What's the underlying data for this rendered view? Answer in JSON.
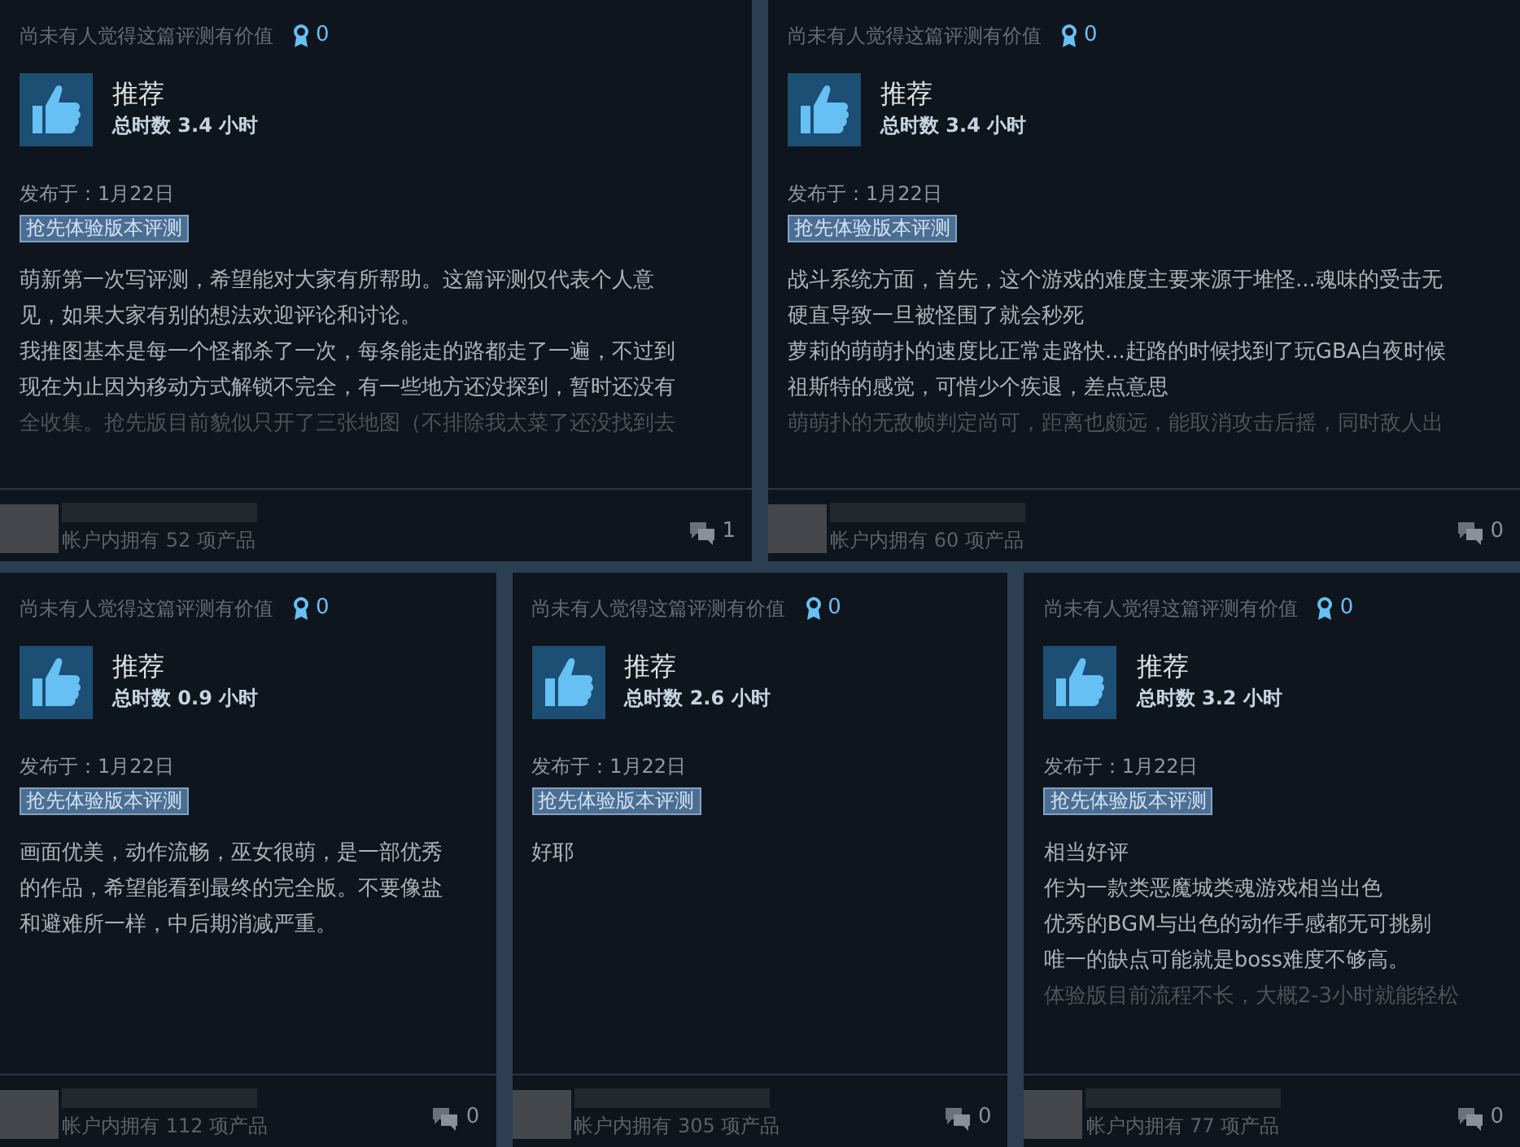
{
  "reviews": [
    {
      "helpful_text": "尚未有人觉得这篇评测有价值",
      "awards": "0",
      "recommended": true,
      "verdict": "推荐",
      "hours": "总时数 3.4 小时",
      "posted": "发布于：1月22日",
      "badge": "抢先体验版本评测",
      "lines": [
        {
          "text": "萌新第一次写评测，希望能对大家有所帮助。这篇评测仅代表个人意",
          "faded": false
        },
        {
          "text": "见，如果大家有别的想法欢迎评论和讨论。",
          "faded": false
        },
        {
          "text": "我推图基本是每一个怪都杀了一次，每条能走的路都走了一遍，不过到",
          "faded": false
        },
        {
          "text": "现在为止因为移动方式解锁不完全，有一些地方还没探到，暂时还没有",
          "faded": false
        },
        {
          "text": "全收集。抢先版目前貌似只开了三张地图（不排除我太菜了还没找到去",
          "faded": true
        }
      ],
      "owned": "帐户内拥有 52 项产品",
      "comments": "1"
    },
    {
      "helpful_text": "尚未有人觉得这篇评测有价值",
      "awards": "0",
      "recommended": true,
      "verdict": "推荐",
      "hours": "总时数 3.4 小时",
      "posted": "发布于：1月22日",
      "badge": "抢先体验版本评测",
      "lines": [
        {
          "text": "战斗系统方面，首先，这个游戏的难度主要来源于堆怪...魂味的受击无",
          "faded": false
        },
        {
          "text": "硬直导致一旦被怪围了就会秒死",
          "faded": false
        },
        {
          "text": "萝莉的萌萌扑的速度比正常走路快...赶路的时候找到了玩GBA白夜时候",
          "faded": false
        },
        {
          "text": "祖斯特的感觉，可惜少个疾退，差点意思",
          "faded": false
        },
        {
          "text": "萌萌扑的无敌帧判定尚可，距离也颇远，能取消攻击后摇，同时敌人出",
          "faded": true
        }
      ],
      "owned": "帐户内拥有 60 项产品",
      "comments": "0"
    },
    {
      "helpful_text": "尚未有人觉得这篇评测有价值",
      "awards": "0",
      "recommended": true,
      "verdict": "推荐",
      "hours": "总时数 0.9 小时",
      "posted": "发布于：1月22日",
      "badge": "抢先体验版本评测",
      "lines": [
        {
          "text": "画面优美，动作流畅，巫女很萌，是一部优秀",
          "faded": false
        },
        {
          "text": "的作品，希望能看到最终的完全版。不要像盐",
          "faded": false
        },
        {
          "text": "和避难所一样，中后期消减严重。",
          "faded": false
        }
      ],
      "owned": "帐户内拥有 112 项产品",
      "comments": "0"
    },
    {
      "helpful_text": "尚未有人觉得这篇评测有价值",
      "awards": "0",
      "recommended": true,
      "verdict": "推荐",
      "hours": "总时数 2.6 小时",
      "posted": "发布于：1月22日",
      "badge": "抢先体验版本评测",
      "lines": [
        {
          "text": "好耶",
          "faded": false
        }
      ],
      "owned": "帐户内拥有 305 项产品",
      "comments": "0"
    },
    {
      "helpful_text": "尚未有人觉得这篇评测有价值",
      "awards": "0",
      "recommended": true,
      "verdict": "推荐",
      "hours": "总时数 3.2 小时",
      "posted": "发布于：1月22日",
      "badge": "抢先体验版本评测",
      "lines": [
        {
          "text": "相当好评",
          "faded": false
        },
        {
          "text": "作为一款类恶魔城类魂游戏相当出色",
          "faded": false
        },
        {
          "text": "优秀的BGM与出色的动作手感都无可挑剔",
          "faded": false
        },
        {
          "text": "唯一的缺点可能就是boss难度不够高。",
          "faded": false
        },
        {
          "text": "体验版目前流程不长，大概2-3小时就能轻松",
          "faded": true
        }
      ],
      "owned": "帐户内拥有 77 项产品",
      "comments": "0"
    }
  ]
}
